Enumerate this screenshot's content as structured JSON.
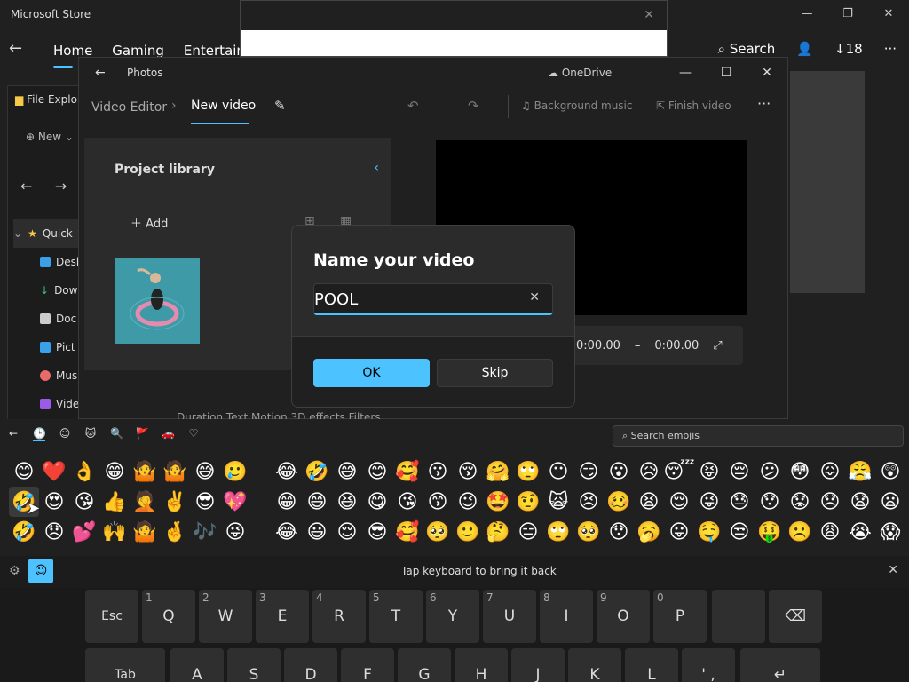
{
  "store": {
    "title": "Microsoft Store",
    "nav": [
      "Home",
      "Gaming",
      "Entertainm"
    ],
    "search": "Search",
    "downloads": "18",
    "more": "···",
    "min": "—",
    "max": "❐",
    "close": "✕",
    "back": "←",
    "panel_close": "✕"
  },
  "explorer": {
    "title": "File Explor",
    "new_label": "New",
    "back": "←",
    "forward": "→",
    "items": [
      {
        "label": "Quick",
        "color": "#f7c948"
      },
      {
        "label": "Desk",
        "color": "#3aa0e8"
      },
      {
        "label": "Dow",
        "color": "#3fbf7f"
      },
      {
        "label": "Doc",
        "color": "#cccccc"
      },
      {
        "label": "Pict",
        "color": "#3aa0e8"
      },
      {
        "label": "Mus",
        "color": "#e86a6a"
      },
      {
        "label": "Vide",
        "color": "#9a5ce8"
      }
    ]
  },
  "photos": {
    "title": "Photos",
    "cloud": "OneDrive",
    "crumb_parent": "Video Editor",
    "crumb_current": "New video",
    "music": "Background music",
    "finish": "Finish video",
    "library_title": "Project library",
    "add_label": "Add",
    "time_start": "0:00.00",
    "time_end": "0:00.00",
    "time_sep": "–",
    "expand": "⤢",
    "bottom_tools": "Duration   Text   Motion   3D effects   Filters"
  },
  "dialog": {
    "title": "Name your video",
    "value": "POOL",
    "clear": "✕",
    "ok": "OK",
    "skip": "Skip"
  },
  "emoji_panel": {
    "back": "←",
    "tabs": [
      "🕒",
      "☺",
      "🐱",
      "🔍",
      "🚩",
      "🚗",
      "♡"
    ],
    "search_placeholder": "Search emojis",
    "left_emojis": [
      "😊",
      "❤️",
      "👌",
      "😁",
      "🤷",
      "🤷",
      "😅",
      "🥲",
      "🤣",
      "😍",
      "😘",
      "👍",
      "🤦",
      "✌️",
      "😎",
      "💖",
      "🤣",
      "😞",
      "💕",
      "🙌",
      "🤷",
      "🤞",
      "🎶",
      "😜"
    ],
    "right_emojis": [
      "😂",
      "🤣",
      "😅",
      "😊",
      "🥰",
      "😗",
      "😚",
      "🤗",
      "🙄",
      "😶",
      "😏",
      "😮",
      "😥",
      "😴",
      "😝",
      "😔",
      "😕",
      "😳",
      "😖",
      "😤",
      "😲",
      "😁",
      "😄",
      "😆",
      "😋",
      "😘",
      "😙",
      "😉",
      "🤩",
      "🤨",
      "🙀",
      "😣",
      "🥴",
      "😫",
      "😌",
      "😜",
      "😓",
      "😯",
      "😟",
      "😞",
      "😧",
      "😦",
      "😂",
      "😃",
      "😌",
      "😎",
      "🥰",
      "🥺",
      "🙂",
      "🤔",
      "😑",
      "🙄",
      "🥺",
      "😯",
      "🥱",
      "😛",
      "🤤",
      "😒",
      "🤑",
      "☹️",
      "😩",
      "😭",
      "😱"
    ]
  },
  "keyboard": {
    "gear": "⚙",
    "emoji_btn": "☺",
    "tip": "Tap keyboard to bring it back",
    "close": "✕",
    "row1": [
      {
        "label": "Esc",
        "num": ""
      },
      {
        "label": "Q",
        "num": "1"
      },
      {
        "label": "W",
        "num": "2"
      },
      {
        "label": "E",
        "num": "3"
      },
      {
        "label": "R",
        "num": "4"
      },
      {
        "label": "T",
        "num": "5"
      },
      {
        "label": "Y",
        "num": "6"
      },
      {
        "label": "U",
        "num": "7"
      },
      {
        "label": "I",
        "num": "8"
      },
      {
        "label": "O",
        "num": "9"
      },
      {
        "label": "P",
        "num": "0"
      },
      {
        "label": "",
        "num": ""
      },
      {
        "label": "⌫",
        "num": ""
      }
    ],
    "row2": [
      "Tab",
      "A",
      "S",
      "D",
      "F",
      "G",
      "H",
      "J",
      "K",
      "L",
      "' ,",
      "↵"
    ]
  },
  "colors": {
    "accent": "#4cc2ff",
    "bg": "#202020"
  }
}
